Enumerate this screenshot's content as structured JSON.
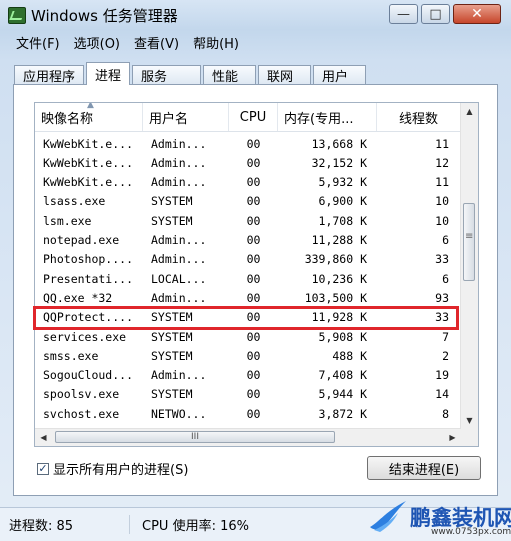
{
  "window": {
    "title": "Windows 任务管理器",
    "controls": {
      "minimize": "—",
      "maximize": "□",
      "close": "✕"
    }
  },
  "menu": [
    "文件(F)",
    "选项(O)",
    "查看(V)",
    "帮助(H)"
  ],
  "tabs": [
    "应用程序",
    "进程",
    "服务",
    "性能",
    "联网",
    "用户"
  ],
  "active_tab": "进程",
  "columns": [
    "映像名称",
    "用户名",
    "CPU",
    "内存(专用...",
    "线程数"
  ],
  "processes": [
    {
      "name": "KwWebKit.e...",
      "user": "Admin...",
      "cpu": "00",
      "mem": "13,668 K",
      "threads": "11"
    },
    {
      "name": "KwWebKit.e...",
      "user": "Admin...",
      "cpu": "00",
      "mem": "32,152 K",
      "threads": "12"
    },
    {
      "name": "KwWebKit.e...",
      "user": "Admin...",
      "cpu": "00",
      "mem": "5,932 K",
      "threads": "11"
    },
    {
      "name": "lsass.exe",
      "user": "SYSTEM",
      "cpu": "00",
      "mem": "6,900 K",
      "threads": "10"
    },
    {
      "name": "lsm.exe",
      "user": "SYSTEM",
      "cpu": "00",
      "mem": "1,708 K",
      "threads": "10"
    },
    {
      "name": "notepad.exe",
      "user": "Admin...",
      "cpu": "00",
      "mem": "11,288 K",
      "threads": "6"
    },
    {
      "name": "Photoshop....",
      "user": "Admin...",
      "cpu": "00",
      "mem": "339,860 K",
      "threads": "33"
    },
    {
      "name": "Presentati...",
      "user": "LOCAL...",
      "cpu": "00",
      "mem": "10,236 K",
      "threads": "6"
    },
    {
      "name": "QQ.exe *32",
      "user": "Admin...",
      "cpu": "00",
      "mem": "103,500 K",
      "threads": "93"
    },
    {
      "name": "QQProtect....",
      "user": "SYSTEM",
      "cpu": "00",
      "mem": "11,928 K",
      "threads": "33"
    },
    {
      "name": "services.exe",
      "user": "SYSTEM",
      "cpu": "00",
      "mem": "5,908 K",
      "threads": "7"
    },
    {
      "name": "smss.exe",
      "user": "SYSTEM",
      "cpu": "00",
      "mem": "488 K",
      "threads": "2"
    },
    {
      "name": "SogouCloud...",
      "user": "Admin...",
      "cpu": "00",
      "mem": "7,408 K",
      "threads": "19"
    },
    {
      "name": "spoolsv.exe",
      "user": "SYSTEM",
      "cpu": "00",
      "mem": "5,944 K",
      "threads": "14"
    },
    {
      "name": "svchost.exe",
      "user": "NETWO...",
      "cpu": "00",
      "mem": "3,872 K",
      "threads": "8"
    }
  ],
  "highlighted_process": "QQProtect....",
  "hscroll_thumb_glyph": "III",
  "show_all_users": {
    "label": "显示所有用户的进程(S)",
    "checked": true,
    "mark": "✓"
  },
  "end_process_button": "结束进程(E)",
  "status": {
    "processes": "进程数: 85",
    "cpu": "CPU 使用率: 16%"
  },
  "watermark": {
    "name": "鹏鑫装机网",
    "url": "www.0753px.com"
  }
}
